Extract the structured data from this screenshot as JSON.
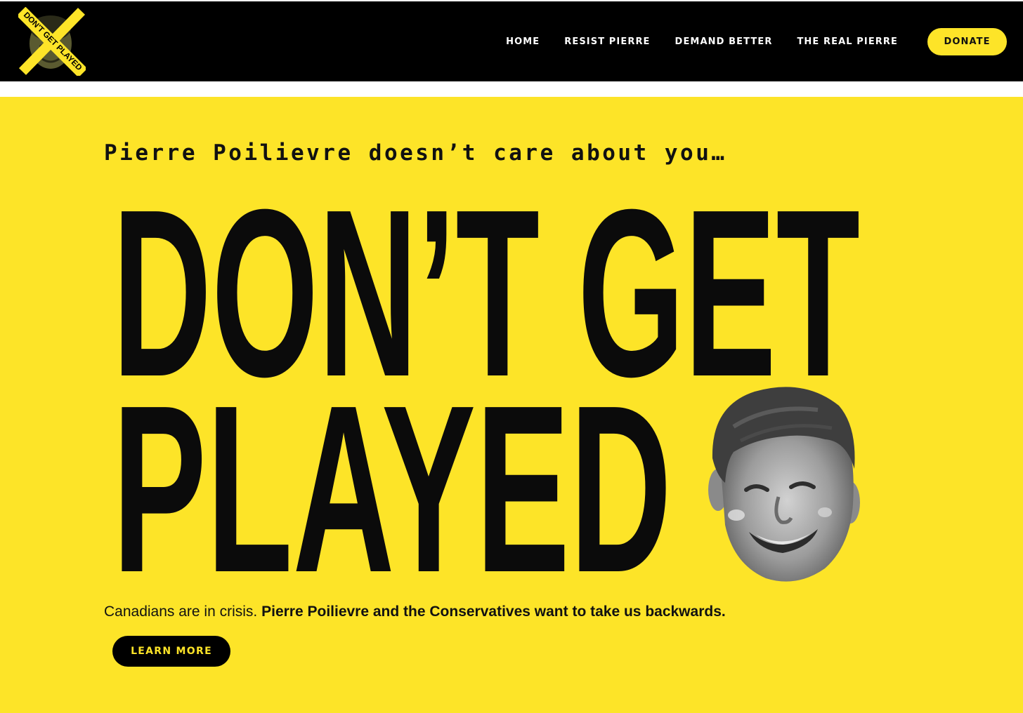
{
  "colors": {
    "accent": "#fde428",
    "dark": "#000000",
    "text": "#111111"
  },
  "header": {
    "logo_text": "DON'T GET PLAYED",
    "nav": [
      {
        "label": "HOME"
      },
      {
        "label": "RESIST PIERRE"
      },
      {
        "label": "DEMAND BETTER"
      },
      {
        "label": "THE REAL PIERRE"
      }
    ],
    "donate_label": "DONATE"
  },
  "hero": {
    "kicker": "Pierre Poilievre doesn’t care about you…",
    "headline_line1": "DON’T GET",
    "headline_line2": "PLAYED",
    "body_plain": "Canadians are in crisis.",
    "body_bold": "Pierre Poilievre and the Conservatives want to take us backwards.",
    "cta_label": "LEARN MORE",
    "portrait_icon": "portrait-illustration"
  }
}
